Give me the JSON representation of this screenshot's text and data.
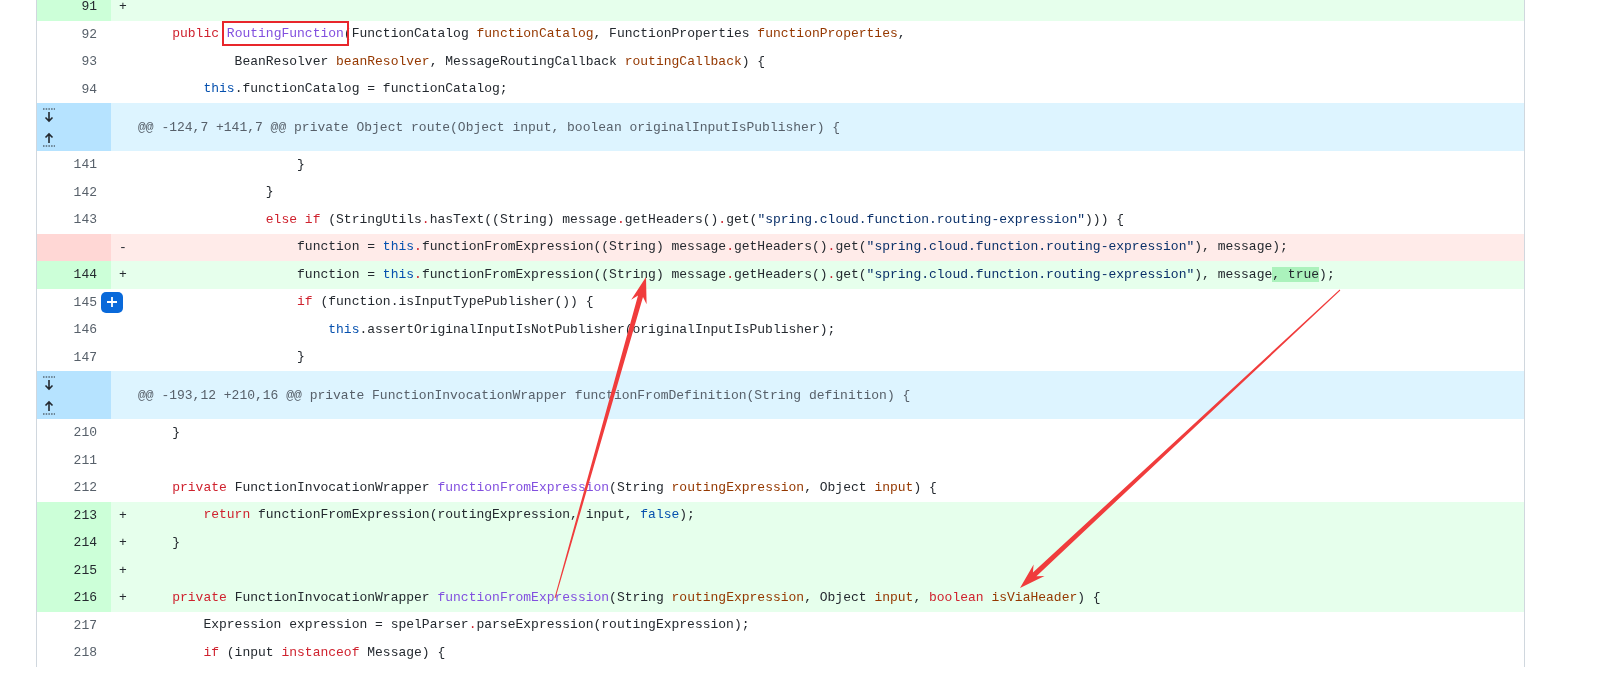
{
  "diff": {
    "rows": [
      {
        "kind": "addition",
        "number": "91",
        "sign": "+",
        "tokens": []
      },
      {
        "kind": "context",
        "number": "92",
        "tokens": [
          {
            "kind": "keyword",
            "text": "    public "
          },
          {
            "kind": "boxed_method",
            "text": "RoutingFunction"
          },
          {
            "kind": "plain",
            "text": "(FunctionCatalog "
          },
          {
            "kind": "param",
            "text": "functionCatalog"
          },
          {
            "kind": "plain",
            "text": ", FunctionProperties "
          },
          {
            "kind": "param",
            "text": "functionProperties"
          },
          {
            "kind": "plain",
            "text": ","
          }
        ]
      },
      {
        "kind": "context",
        "number": "93",
        "tokens": [
          {
            "kind": "plain",
            "text": "            BeanResolver "
          },
          {
            "kind": "param",
            "text": "beanResolver"
          },
          {
            "kind": "plain",
            "text": ", MessageRoutingCallback "
          },
          {
            "kind": "param",
            "text": "routingCallback"
          },
          {
            "kind": "plain",
            "text": ") {"
          }
        ]
      },
      {
        "kind": "context",
        "number": "94",
        "tokens": [
          {
            "kind": "constant",
            "text": "        this"
          },
          {
            "kind": "plain",
            "text": ".functionCatalog = functionCatalog;"
          }
        ]
      },
      {
        "kind": "hunk",
        "header": "@@ -124,7 +141,7 @@ private Object route(Object input, boolean originalInputIsPublisher) {"
      },
      {
        "kind": "context",
        "number": "141",
        "tokens": [
          {
            "kind": "plain",
            "text": "                    }"
          }
        ]
      },
      {
        "kind": "context",
        "number": "142",
        "tokens": [
          {
            "kind": "plain",
            "text": "                }"
          }
        ]
      },
      {
        "kind": "context",
        "number": "143",
        "tokens": [
          {
            "kind": "keyword",
            "text": "                else if"
          },
          {
            "kind": "plain",
            "text": " (StringUtils"
          },
          {
            "kind": "keyword",
            "text": "."
          },
          {
            "kind": "plain",
            "text": "hasText((String) message"
          },
          {
            "kind": "keyword",
            "text": "."
          },
          {
            "kind": "plain",
            "text": "getHeaders()"
          },
          {
            "kind": "keyword",
            "text": "."
          },
          {
            "kind": "plain",
            "text": "get("
          },
          {
            "kind": "string",
            "text": "\"spring.cloud.function.routing-expression\""
          },
          {
            "kind": "plain",
            "text": "))) {"
          }
        ]
      },
      {
        "kind": "deletion",
        "sign": "-",
        "tokens": [
          {
            "kind": "plain",
            "text": "                    function = "
          },
          {
            "kind": "constant",
            "text": "this"
          },
          {
            "kind": "keyword",
            "text": "."
          },
          {
            "kind": "plain",
            "text": "functionFromExpression((String) message"
          },
          {
            "kind": "keyword",
            "text": "."
          },
          {
            "kind": "plain",
            "text": "getHeaders()"
          },
          {
            "kind": "keyword",
            "text": "."
          },
          {
            "kind": "plain",
            "text": "get("
          },
          {
            "kind": "string",
            "text": "\"spring.cloud.function.routing-expression\""
          },
          {
            "kind": "plain",
            "text": "), message);"
          }
        ]
      },
      {
        "kind": "addition",
        "number": "144",
        "sign": "+",
        "tokens": [
          {
            "kind": "plain",
            "text": "                    function = "
          },
          {
            "kind": "constant",
            "text": "this"
          },
          {
            "kind": "keyword",
            "text": "."
          },
          {
            "kind": "plain",
            "text": "functionFromExpression((String) message"
          },
          {
            "kind": "keyword",
            "text": "."
          },
          {
            "kind": "plain",
            "text": "getHeaders()"
          },
          {
            "kind": "keyword",
            "text": "."
          },
          {
            "kind": "plain",
            "text": "get("
          },
          {
            "kind": "string",
            "text": "\"spring.cloud.function.routing-expression\""
          },
          {
            "kind": "plain",
            "text": "), message"
          },
          {
            "kind": "added_word",
            "text": ", true"
          },
          {
            "kind": "plain",
            "text": ");"
          }
        ]
      },
      {
        "kind": "context",
        "number": "145",
        "comment_button": true,
        "tokens": [
          {
            "kind": "keyword",
            "text": "                    if"
          },
          {
            "kind": "plain",
            "text": " (function.isInputTypePublisher()) {"
          }
        ]
      },
      {
        "kind": "context",
        "number": "146",
        "tokens": [
          {
            "kind": "constant",
            "text": "                        this"
          },
          {
            "kind": "plain",
            "text": ".assertOriginalInputIsNotPublisher(originalInputIsPublisher);"
          }
        ]
      },
      {
        "kind": "context",
        "number": "147",
        "tokens": [
          {
            "kind": "plain",
            "text": "                    }"
          }
        ]
      },
      {
        "kind": "hunk",
        "header": "@@ -193,12 +210,16 @@ private FunctionInvocationWrapper functionFromDefinition(String definition) {"
      },
      {
        "kind": "context",
        "number": "210",
        "tokens": [
          {
            "kind": "plain",
            "text": "    }"
          }
        ]
      },
      {
        "kind": "context",
        "number": "211",
        "tokens": []
      },
      {
        "kind": "context",
        "number": "212",
        "tokens": [
          {
            "kind": "keyword",
            "text": "    private"
          },
          {
            "kind": "plain",
            "text": " FunctionInvocationWrapper "
          },
          {
            "kind": "method",
            "text": "functionFromExpression"
          },
          {
            "kind": "plain",
            "text": "(String "
          },
          {
            "kind": "param",
            "text": "routingExpression"
          },
          {
            "kind": "plain",
            "text": ", Object "
          },
          {
            "kind": "param",
            "text": "input"
          },
          {
            "kind": "plain",
            "text": ") {"
          }
        ]
      },
      {
        "kind": "addition",
        "number": "213",
        "sign": "+",
        "tokens": [
          {
            "kind": "keyword",
            "text": "        return"
          },
          {
            "kind": "plain",
            "text": " functionFromExpression(routingExpression, input, "
          },
          {
            "kind": "constant",
            "text": "false"
          },
          {
            "kind": "plain",
            "text": ");"
          }
        ]
      },
      {
        "kind": "addition",
        "number": "214",
        "sign": "+",
        "tokens": [
          {
            "kind": "plain",
            "text": "    }"
          }
        ]
      },
      {
        "kind": "addition",
        "number": "215",
        "sign": "+",
        "tokens": []
      },
      {
        "kind": "addition",
        "number": "216",
        "sign": "+",
        "tokens": [
          {
            "kind": "keyword",
            "text": "    private"
          },
          {
            "kind": "plain",
            "text": " FunctionInvocationWrapper "
          },
          {
            "kind": "method",
            "text": "functionFromExpression"
          },
          {
            "kind": "plain",
            "text": "(String "
          },
          {
            "kind": "param",
            "text": "routingExpression"
          },
          {
            "kind": "plain",
            "text": ", Object "
          },
          {
            "kind": "param",
            "text": "input"
          },
          {
            "kind": "plain",
            "text": ", "
          },
          {
            "kind": "keyword",
            "text": "boolean "
          },
          {
            "kind": "param",
            "text": "isViaHeader"
          },
          {
            "kind": "plain",
            "text": ") {"
          }
        ]
      },
      {
        "kind": "context",
        "number": "217",
        "tokens": [
          {
            "kind": "plain",
            "text": "        Expression expression = spelParser"
          },
          {
            "kind": "keyword",
            "text": "."
          },
          {
            "kind": "plain",
            "text": "parseExpression(routingExpression);"
          }
        ]
      },
      {
        "kind": "context",
        "number": "218",
        "tokens": [
          {
            "kind": "keyword",
            "text": "        if"
          },
          {
            "kind": "plain",
            "text": " (input "
          },
          {
            "kind": "keyword",
            "text": "instanceof"
          },
          {
            "kind": "plain",
            "text": " Message) {"
          }
        ]
      }
    ]
  }
}
